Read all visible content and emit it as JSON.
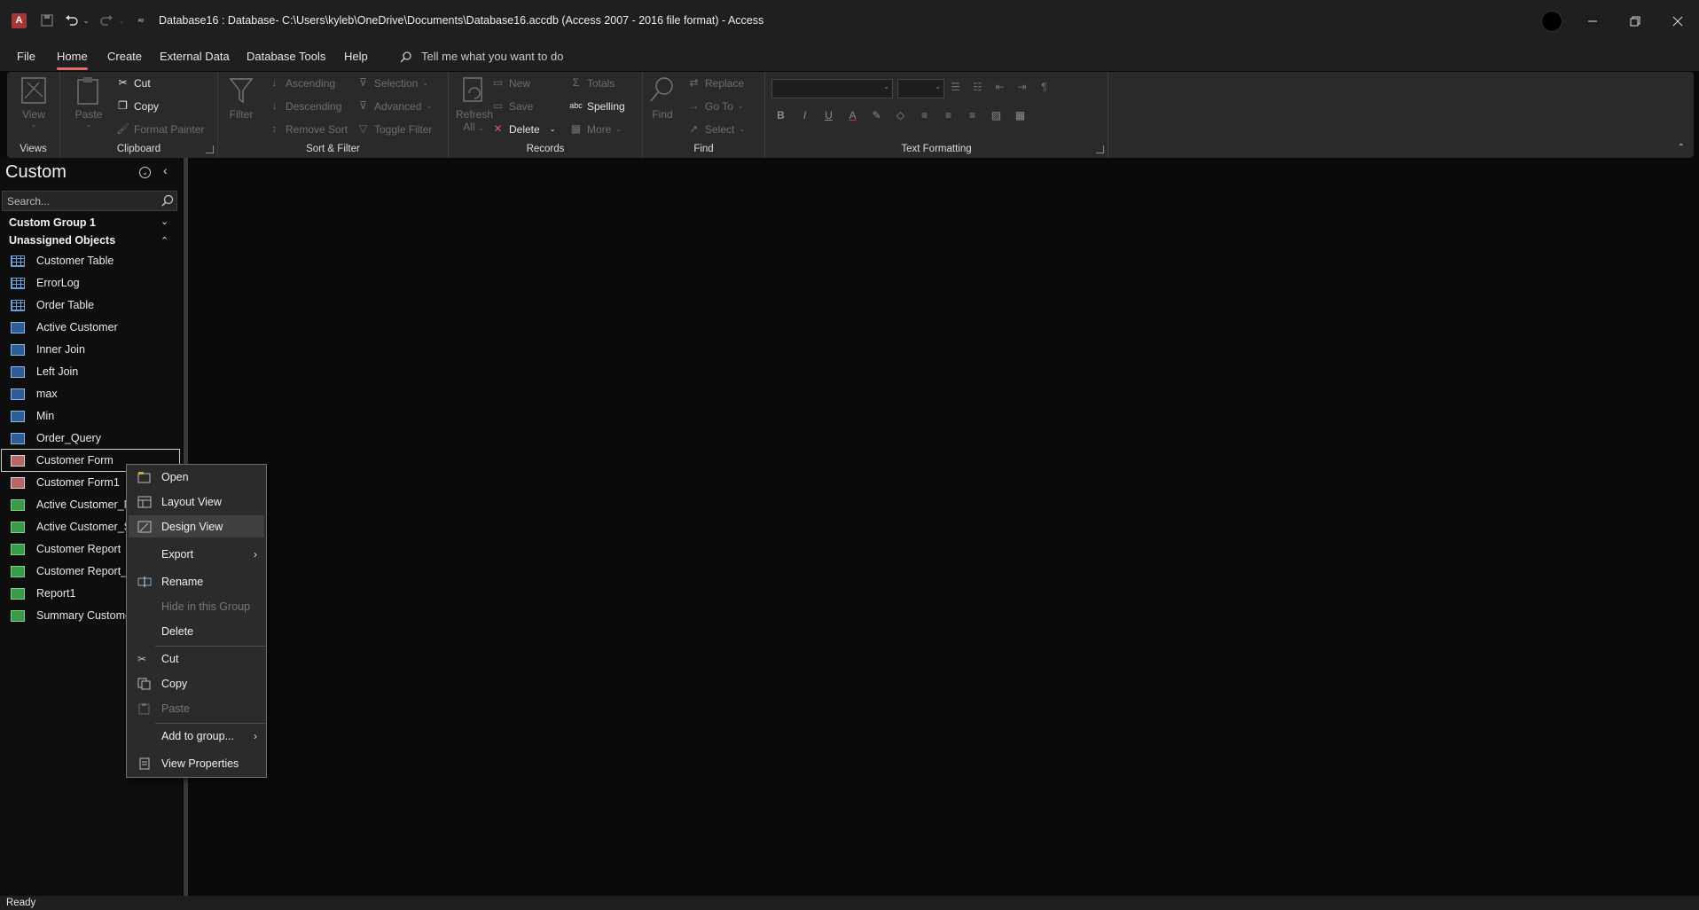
{
  "titlebar": {
    "title": "Database16 : Database- C:\\Users\\kyleb\\OneDrive\\Documents\\Database16.accdb (Access 2007 - 2016 file format)  -  Access",
    "app_icon_letter": "A"
  },
  "menu_tabs": [
    "File",
    "Home",
    "Create",
    "External Data",
    "Database Tools",
    "Help"
  ],
  "active_tab": "Home",
  "tell_me": "Tell me what you want to do",
  "ribbon": {
    "views": {
      "view": "View",
      "label": "Views"
    },
    "clipboard": {
      "paste": "Paste",
      "cut": "Cut",
      "copy": "Copy",
      "format_painter": "Format Painter",
      "label": "Clipboard"
    },
    "sort_filter": {
      "filter": "Filter",
      "ascending": "Ascending",
      "descending": "Descending",
      "remove_sort": "Remove Sort",
      "selection": "Selection",
      "advanced": "Advanced",
      "toggle_filter": "Toggle Filter",
      "label": "Sort & Filter"
    },
    "records": {
      "refresh": "Refresh",
      "refresh_sub": "All",
      "new": "New",
      "save": "Save",
      "delete": "Delete",
      "totals": "Totals",
      "spelling": "Spelling",
      "more": "More",
      "label": "Records"
    },
    "find": {
      "find": "Find",
      "replace": "Replace",
      "goto": "Go To",
      "select": "Select",
      "label": "Find"
    },
    "text_formatting": {
      "label": "Text Formatting",
      "bold": "B",
      "italic": "I",
      "underline": "U"
    }
  },
  "nav": {
    "title": "Custom",
    "search_placeholder": "Search...",
    "groups": [
      {
        "label": "Custom Group 1",
        "state": "collapsed"
      },
      {
        "label": "Unassigned Objects",
        "state": "expanded"
      }
    ],
    "items": [
      {
        "label": "Customer Table",
        "type": "table"
      },
      {
        "label": "ErrorLog",
        "type": "table"
      },
      {
        "label": "Order Table",
        "type": "table"
      },
      {
        "label": "Active Customer",
        "type": "query"
      },
      {
        "label": "Inner Join",
        "type": "query"
      },
      {
        "label": "Left Join",
        "type": "query"
      },
      {
        "label": "max",
        "type": "query"
      },
      {
        "label": "Min",
        "type": "query"
      },
      {
        "label": "Order_Query",
        "type": "query"
      },
      {
        "label": "Customer Form",
        "type": "form"
      },
      {
        "label": "Customer Form1",
        "type": "form"
      },
      {
        "label": "Active Customer_M",
        "type": "report"
      },
      {
        "label": "Active Customer_S",
        "type": "report"
      },
      {
        "label": "Customer Report",
        "type": "report"
      },
      {
        "label": "Customer Report_S",
        "type": "report"
      },
      {
        "label": "Report1",
        "type": "report"
      },
      {
        "label": "Summary Custome",
        "type": "report"
      }
    ],
    "selected_item": "Customer Form"
  },
  "context_menu": {
    "items": [
      {
        "label": "Open",
        "enabled": true
      },
      {
        "label": "Layout View",
        "enabled": true
      },
      {
        "label": "Design View",
        "enabled": true,
        "highlighted": true
      },
      {
        "label": "Export",
        "enabled": true,
        "submenu": true
      },
      {
        "label": "Rename",
        "enabled": true
      },
      {
        "label": "Hide in this Group",
        "enabled": false
      },
      {
        "label": "Delete",
        "enabled": true
      },
      {
        "label": "Cut",
        "enabled": true
      },
      {
        "label": "Copy",
        "enabled": true
      },
      {
        "label": "Paste",
        "enabled": false
      },
      {
        "label": "Add to group...",
        "enabled": true,
        "submenu": true
      },
      {
        "label": "View Properties",
        "enabled": true
      }
    ]
  },
  "status": {
    "text": "Ready"
  },
  "colors": {
    "accent": "#e06b6d",
    "background": "#0a0a0a",
    "ribbon": "#2a2a2a",
    "titlebar": "#1f1f1f"
  }
}
